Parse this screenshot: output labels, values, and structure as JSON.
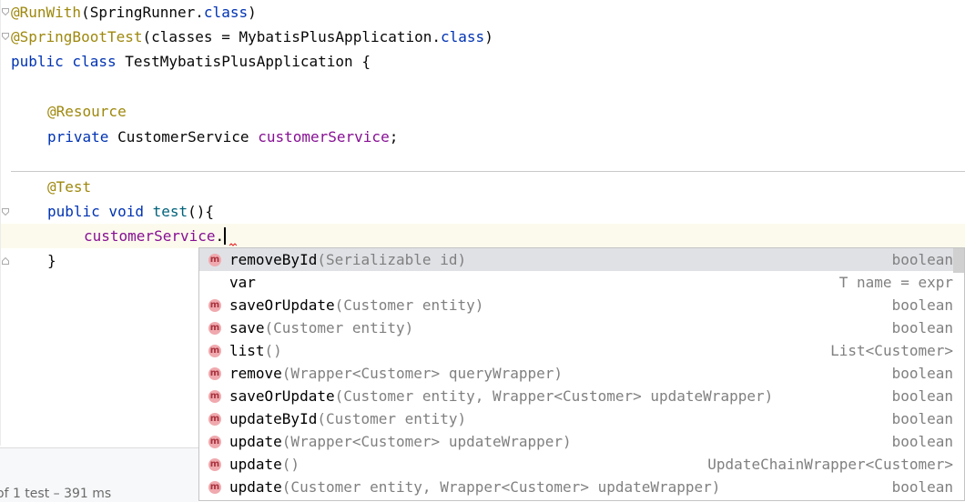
{
  "code": {
    "line1": {
      "ann": "@RunWith",
      "rest_open": "(SpringRunner.",
      "kw": "class",
      "rest_close": ")"
    },
    "line2": {
      "ann": "@SpringBootTest",
      "rest_open": "(classes = MybatisPlusApplication.",
      "kw": "class",
      "rest_close": ")"
    },
    "line3": {
      "kw": "public class",
      "name": " TestMybatisPlusApplication {"
    },
    "line5": {
      "ann": "@Resource"
    },
    "line6": {
      "kw": "private",
      "type": " CustomerService ",
      "field": "customerService",
      "end": ";"
    },
    "line8": {
      "ann": "@Test"
    },
    "line9": {
      "kw": "public void",
      "fn": " test",
      "end": "(){"
    },
    "line10": {
      "field": "customerService",
      "dot": "."
    },
    "line11": {
      "brace": "}"
    }
  },
  "status": {
    "text": "of 1 test – 391 ms"
  },
  "completion": {
    "items": [
      {
        "icon": "m",
        "name": "removeById",
        "params": "(Serializable id)",
        "type": "boolean",
        "selected": true
      },
      {
        "icon": "",
        "name": "var",
        "params": "",
        "type": "T name = expr"
      },
      {
        "icon": "m",
        "name": "saveOrUpdate",
        "params": "(Customer entity)",
        "type": "boolean"
      },
      {
        "icon": "m",
        "name": "save",
        "params": "(Customer entity)",
        "type": "boolean"
      },
      {
        "icon": "m",
        "name": "list",
        "params": "()",
        "type": "List<Customer>"
      },
      {
        "icon": "m",
        "name": "remove",
        "params": "(Wrapper<Customer> queryWrapper)",
        "type": "boolean"
      },
      {
        "icon": "m",
        "name": "saveOrUpdate",
        "params": "(Customer entity, Wrapper<Customer> updateWrapper)",
        "type": "boolean"
      },
      {
        "icon": "m",
        "name": "updateById",
        "params": "(Customer entity)",
        "type": "boolean"
      },
      {
        "icon": "m",
        "name": "update",
        "params": "(Wrapper<Customer> updateWrapper)",
        "type": "boolean"
      },
      {
        "icon": "m",
        "name": "update",
        "params": "()",
        "type": "UpdateChainWrapper<Customer>"
      },
      {
        "icon": "m",
        "name": "update",
        "params": "(Customer entity, Wrapper<Customer> updateWrapper)",
        "type": "boolean"
      }
    ]
  },
  "colors": {
    "annotation": "#9e880d",
    "keyword": "#0033b3",
    "field": "#871094",
    "method_icon": "#f0a9ae"
  }
}
